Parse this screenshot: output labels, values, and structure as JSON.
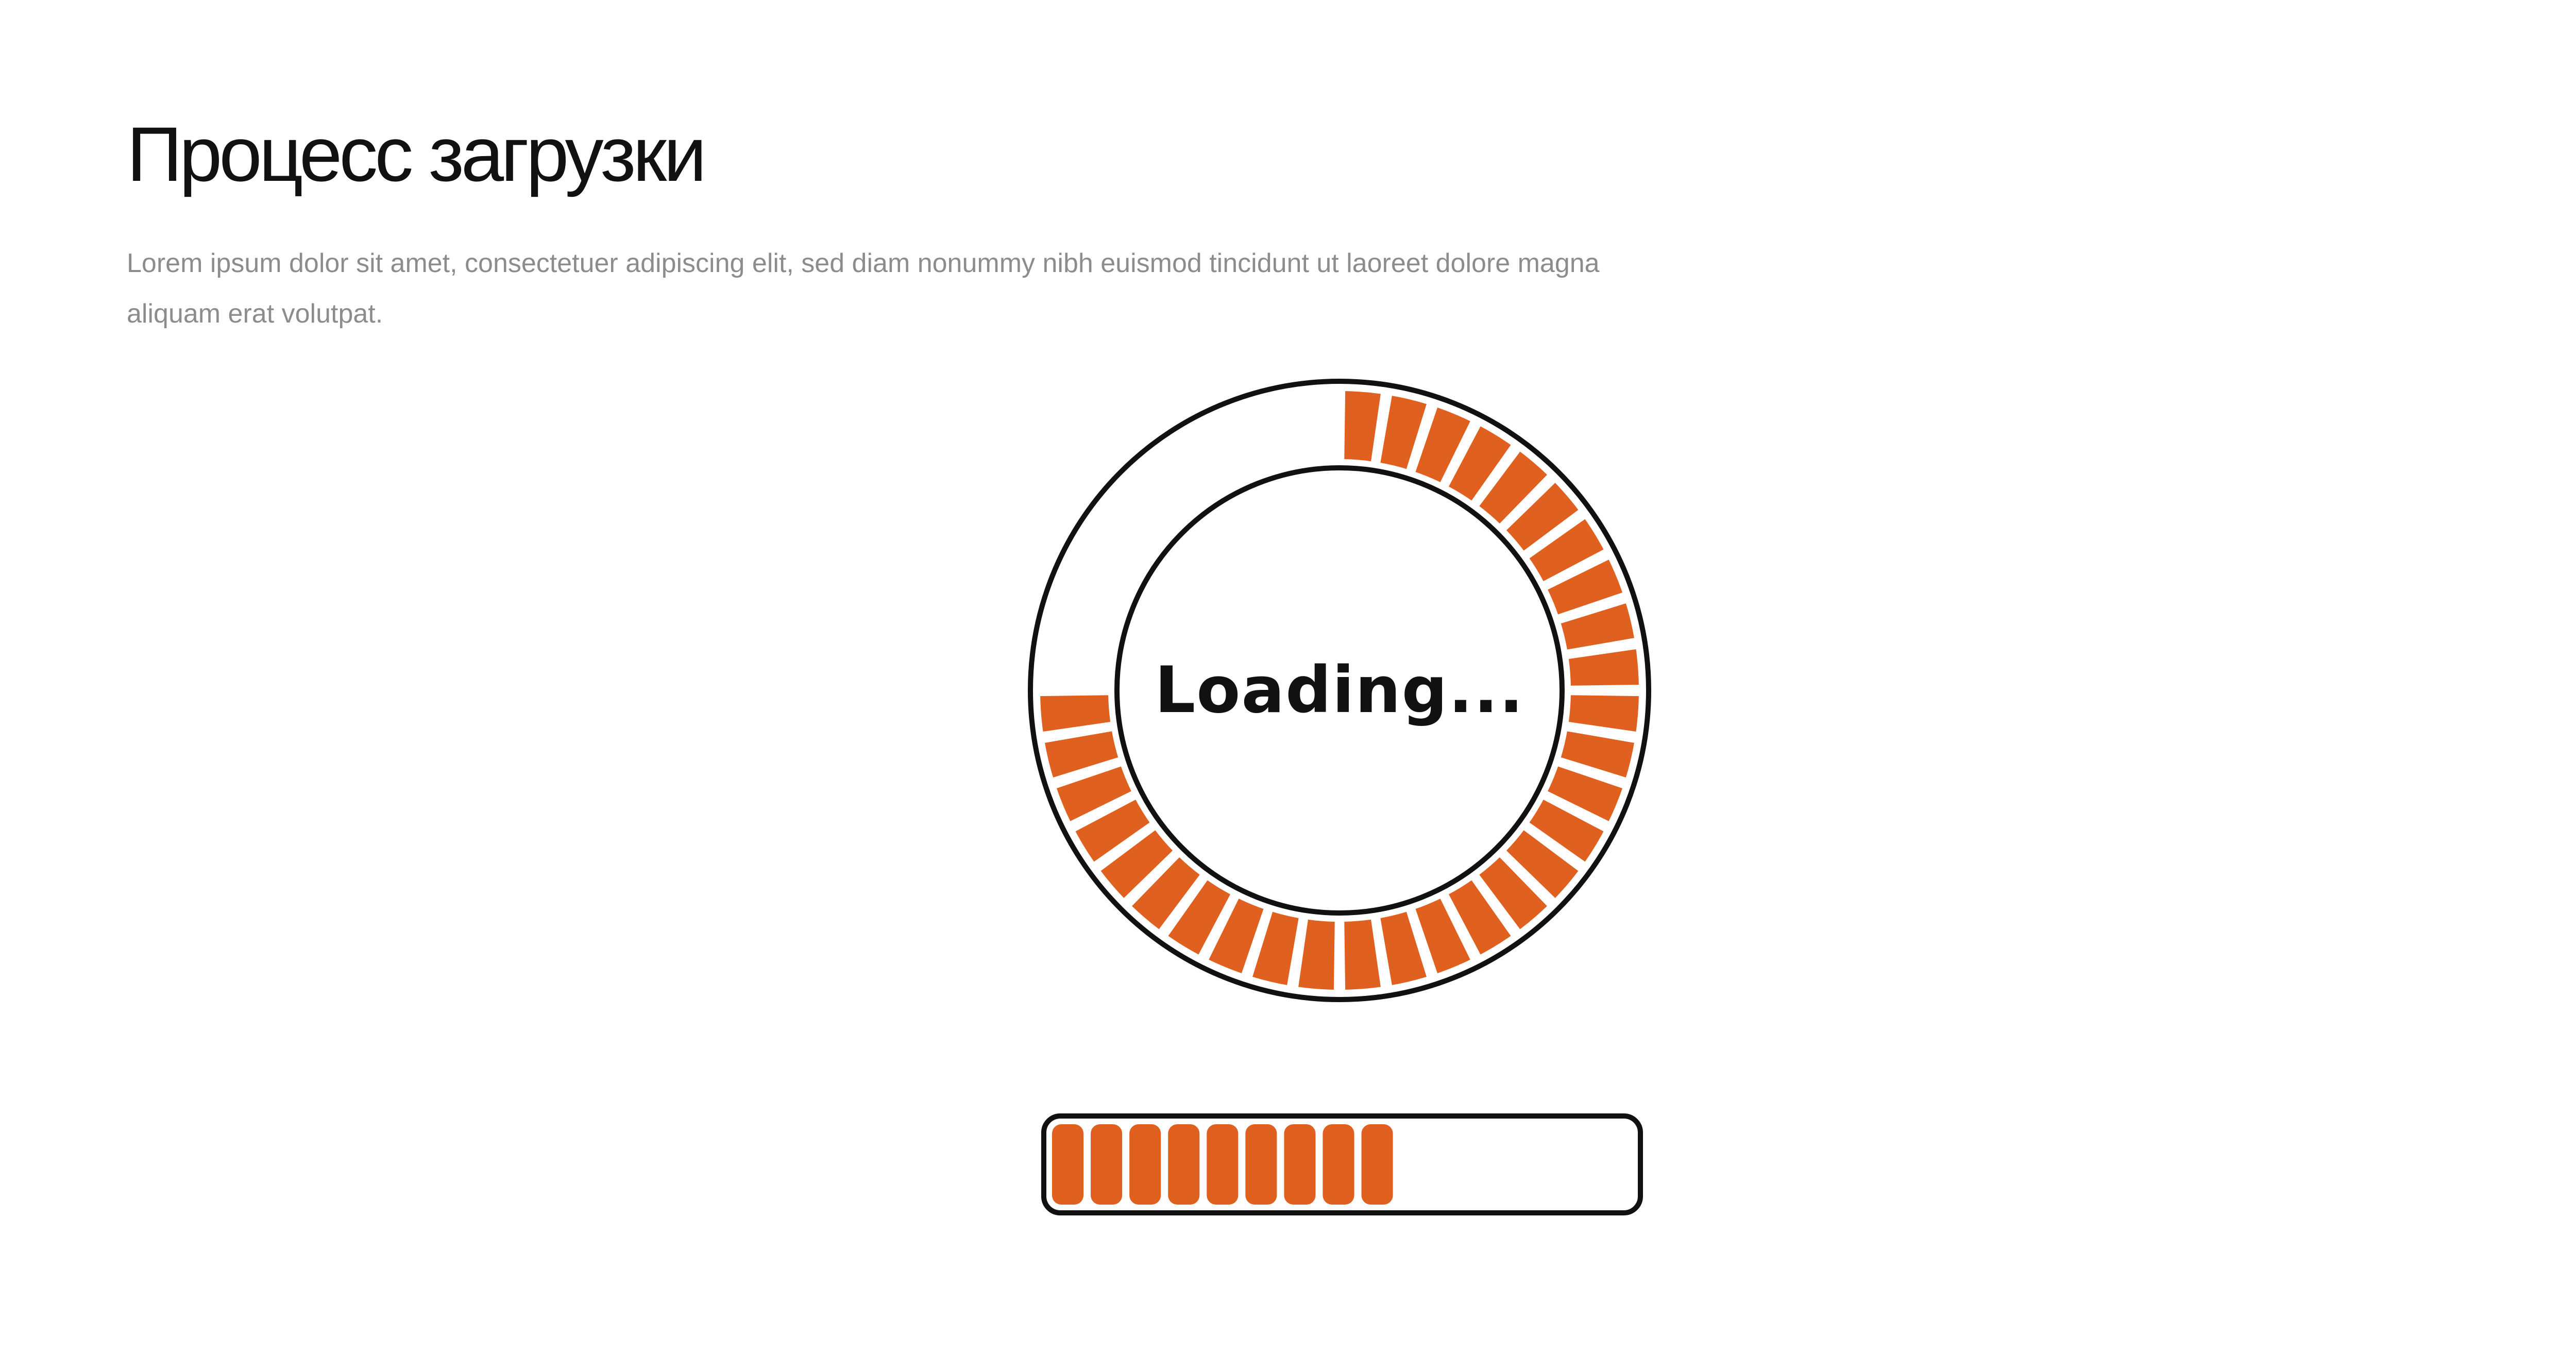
{
  "header": {
    "title": "Процесс загрузки",
    "description": "Lorem ipsum dolor sit amet, consectetuer adipiscing elit, sed diam nonummy nibh euismod tincidunt ut laoreet dolore magna aliquam erat volutpat."
  },
  "circular_loader": {
    "label": "Loading...",
    "progress_fraction": 0.75,
    "accent_color": "#e0601f",
    "outline_color": "#111111",
    "segment_count": 40
  },
  "linear_loader": {
    "progress_fraction": 0.6,
    "accent_color": "#e0601f",
    "outline_color": "#111111",
    "segment_count": 9
  }
}
